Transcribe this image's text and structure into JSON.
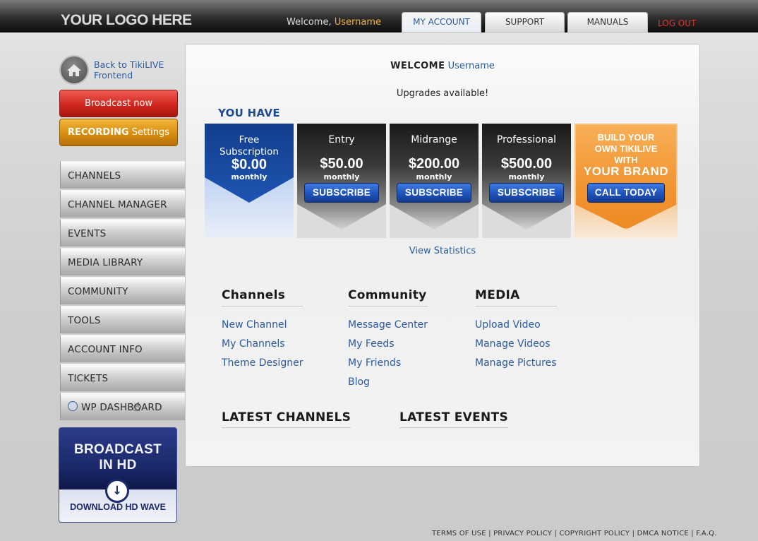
{
  "header": {
    "logo": "YOUR LOGO HERE",
    "welcome_prefix": "Welcome,",
    "username": "Username",
    "tabs": [
      {
        "label": "MY ACCOUNT",
        "active": true
      },
      {
        "label": "SUPPORT",
        "active": false
      },
      {
        "label": "MANUALS",
        "active": false
      }
    ],
    "logout": "LOG OUT"
  },
  "sidebar": {
    "back_link": "Back to TikiLIVE Frontend",
    "broadcast_button": "Broadcast now",
    "recording_bold": "RECORDING",
    "recording_rest": "Settings",
    "nav": [
      "CHANNELS",
      "CHANNEL MANAGER",
      "EVENTS",
      "MEDIA LIBRARY",
      "COMMUNITY",
      "TOOLS",
      "ACCOUNT INFO",
      "TICKETS",
      "WP DASHBOARD"
    ],
    "hd_promo": {
      "title_line1": "BROADCAST",
      "title_line2": "IN HD",
      "download": "DOWNLOAD HD WAVE"
    }
  },
  "main": {
    "welcome_label": "WELCOME",
    "username": "Username",
    "upgrades": "Upgrades available!",
    "you_have": "YOU HAVE",
    "plans": [
      {
        "name_line1": "Free",
        "name_line2": "Subscription",
        "price": "$0.00",
        "period": "monthly"
      },
      {
        "name": "Entry",
        "price": "$50.00",
        "period": "monthly",
        "button": "SUBSCRIBE"
      },
      {
        "name": "Midrange",
        "price": "$200.00",
        "period": "monthly",
        "button": "SUBSCRIBE"
      },
      {
        "name": "Professional",
        "price": "$500.00",
        "period": "monthly",
        "button": "SUBSCRIBE"
      }
    ],
    "brand": {
      "line1": "BUILD YOUR",
      "line2": "OWN TIKILIVE",
      "line3": "WITH",
      "line4": "YOUR BRAND",
      "button": "CALL TODAY"
    },
    "view_statistics": "View Statistics",
    "columns": [
      {
        "title": "Channels",
        "links": [
          "New Channel",
          "My Channels",
          "Theme Designer"
        ]
      },
      {
        "title": "Community",
        "links": [
          "Message Center",
          "My Feeds",
          "My Friends",
          "Blog"
        ]
      },
      {
        "title": "MEDIA",
        "links": [
          "Upload Video",
          "Manage Videos",
          "Manage Pictures"
        ]
      }
    ],
    "latest_channels": "LATEST CHANNELS",
    "latest_events": "LATEST EVENTS"
  },
  "footer": {
    "links": [
      "TERMS OF USE",
      "PRIVACY POLICY",
      "COPYRIGHT POLICY",
      "DMCA NOTICE",
      "F.A.Q."
    ],
    "separator": "|"
  }
}
